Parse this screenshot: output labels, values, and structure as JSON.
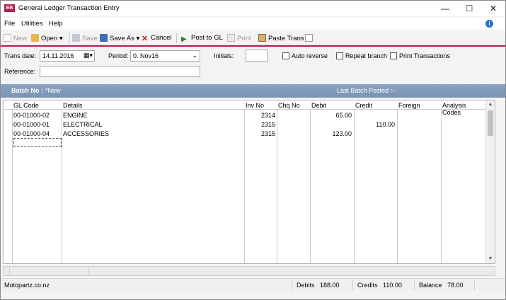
{
  "window": {
    "title": "General Ledger Transaction Entry",
    "icon_text": "EB",
    "minimize_icon": "minimize-icon",
    "maximize_icon": "maximize-icon",
    "close_icon": "close-icon"
  },
  "menu": {
    "file": "File",
    "utilities": "Utilities",
    "help": "Help",
    "help_icon": "info-icon"
  },
  "toolbar": {
    "new": "New",
    "open": "Open",
    "save": "Save",
    "save_as": "Save As",
    "cancel": "Cancel",
    "post": "Post to GL",
    "print": "Print",
    "paste": "Paste Trans"
  },
  "form": {
    "trans_date_label": "Trans date:",
    "trans_date": "14.11.2016",
    "period_label": "Period:",
    "period": "0. Nov16",
    "initials_label": "Initials:",
    "initials": "",
    "auto_reverse": "Auto reverse",
    "repeat_branch": "Repeat branch",
    "print_transactions": "Print Transactions",
    "reference_label": "Reference:",
    "reference": ""
  },
  "batch": {
    "label": "Batch No :",
    "value": "*New",
    "last_posted_label": "Last Batch Posted :",
    "last_posted_value": "--"
  },
  "grid": {
    "columns": [
      "GL Code",
      "Details",
      "Inv No",
      "Chq No",
      "Debit",
      "Credit",
      "Foreign",
      "Analysis Codes"
    ],
    "rows": [
      {
        "gl": "00-01000-02",
        "details": "ENGINE",
        "inv": "2314",
        "chq": "",
        "debit": "65.00",
        "credit": "",
        "foreign": "",
        "analysis": ""
      },
      {
        "gl": "00-01000-01",
        "details": "ELECTRICAL",
        "inv": "2315",
        "chq": "",
        "debit": "",
        "credit": "110.00",
        "foreign": "",
        "analysis": ""
      },
      {
        "gl": "00-01000-04",
        "details": "ACCESSORIES",
        "inv": "2315",
        "chq": "",
        "debit": "123.00",
        "credit": "",
        "foreign": "",
        "analysis": ""
      }
    ]
  },
  "status": {
    "company": "Motopartz.co.nz",
    "debits_label": "Debits",
    "debits": "188.00",
    "credits_label": "Credits",
    "credits": "110.00",
    "balance_label": "Balance",
    "balance": "78.00"
  },
  "colors": {
    "accent": "#b01f58",
    "batch_bar": "#7f98b8"
  }
}
